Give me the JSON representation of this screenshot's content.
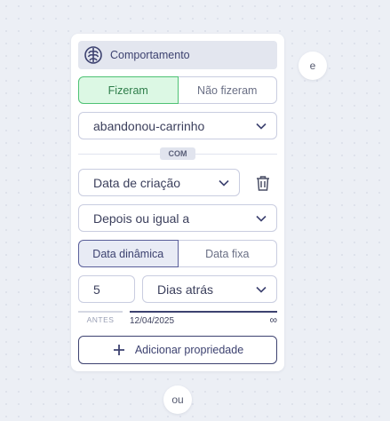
{
  "behavior": {
    "header_title": "Comportamento",
    "header_icon": "brain-icon",
    "performed_toggle": {
      "options": [
        "Fizeram",
        "Não fizeram"
      ],
      "selected": "Fizeram",
      "active_color": "#dcf8e4"
    },
    "event_select": {
      "value": "abandonou-carrinho"
    },
    "with_badge": "COM",
    "property_select": {
      "value": "Data de criação"
    },
    "operator_select": {
      "value": "Depois ou igual a"
    },
    "date_mode_toggle": {
      "options": [
        "Data dinâmica",
        "Data fixa"
      ],
      "selected": "Data dinâmica"
    },
    "amount_input": {
      "value": "5"
    },
    "unit_select": {
      "value": "Dias atrás"
    },
    "range": {
      "before_label": "ANTES",
      "date_value": "12/04/2025",
      "end_symbol": "∞"
    },
    "add_property_button": {
      "label": "Adicionar propriedade"
    }
  },
  "connectors": {
    "and_label": "e",
    "or_label": "ou"
  },
  "colors": {
    "accent": "#3d4270",
    "success_bg": "#dcf8e4",
    "success_border": "#4ec274",
    "border": "#c9cde0",
    "canvas": "#eceff5"
  }
}
